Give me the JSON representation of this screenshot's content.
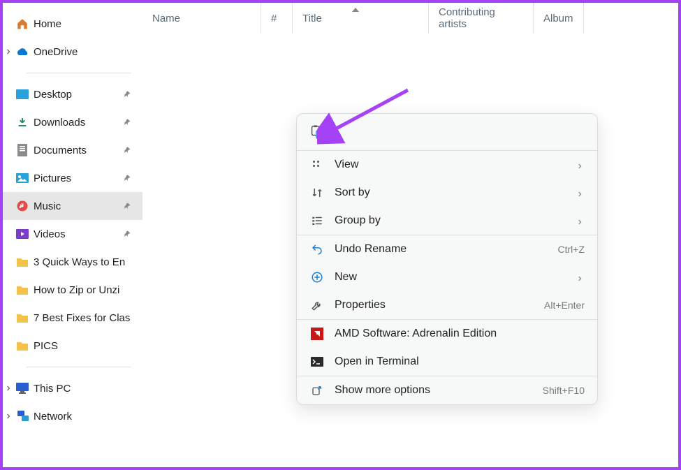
{
  "sidebar": {
    "home": "Home",
    "onedrive": "OneDrive",
    "quick": [
      {
        "label": "Desktop"
      },
      {
        "label": "Downloads"
      },
      {
        "label": "Documents"
      },
      {
        "label": "Pictures"
      },
      {
        "label": "Music"
      },
      {
        "label": "Videos"
      }
    ],
    "folders": [
      "3 Quick Ways to En",
      "How to Zip or Unzi",
      "7 Best Fixes for Clas",
      "PICS"
    ],
    "thispc": "This PC",
    "network": "Network"
  },
  "columns": {
    "name": "Name",
    "hash": "#",
    "title": "Title",
    "artists": "Contributing artists",
    "album": "Album"
  },
  "ctx": {
    "paste": "Paste",
    "view": "View",
    "sort": "Sort by",
    "group": "Group by",
    "undo": "Undo Rename",
    "undo_hint": "Ctrl+Z",
    "new": "New",
    "props": "Properties",
    "props_hint": "Alt+Enter",
    "amd": "AMD Software: Adrenalin Edition",
    "terminal": "Open in Terminal",
    "more": "Show more options",
    "more_hint": "Shift+F10"
  }
}
